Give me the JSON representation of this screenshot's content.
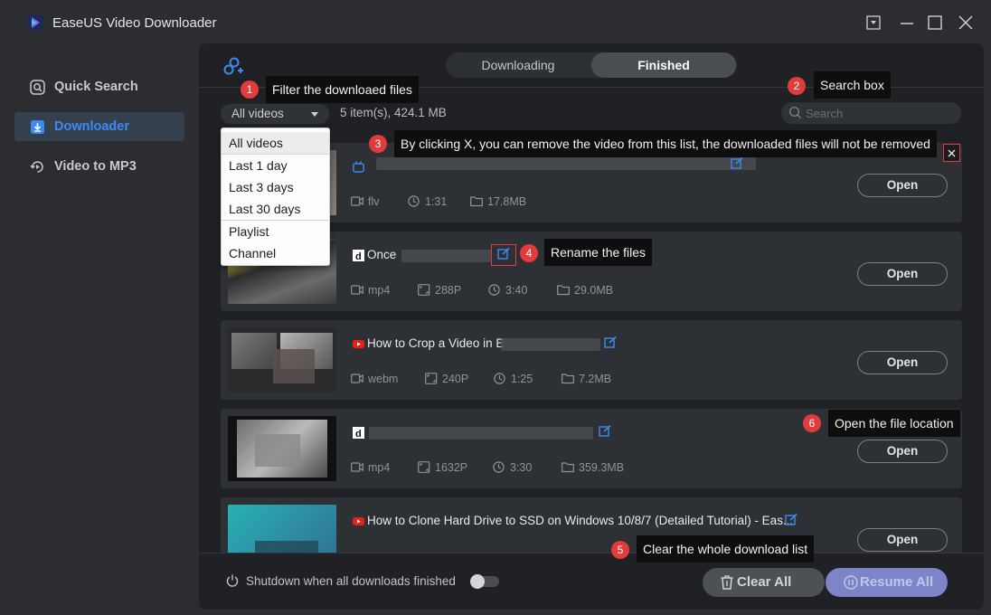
{
  "app": {
    "title": "EaseUS Video Downloader"
  },
  "sidebar": {
    "items": [
      {
        "label": "Quick Search",
        "icon": "search-icon",
        "active": false
      },
      {
        "label": "Downloader",
        "icon": "download-icon",
        "active": true
      },
      {
        "label": "Video to MP3",
        "icon": "convert-icon",
        "active": false
      }
    ]
  },
  "tabs": [
    {
      "label": "Downloading",
      "active": false
    },
    {
      "label": "Finished",
      "active": true
    }
  ],
  "filter": {
    "selected": "All videos",
    "count_text": "5 item(s), 424.1 MB",
    "options": [
      "All videos",
      "Last 1 day",
      "Last 3 days",
      "Last 30 days",
      "Playlist",
      "Channel"
    ]
  },
  "search": {
    "placeholder": "Search"
  },
  "videos": [
    {
      "title": "",
      "source": "bilibili-icon",
      "meta": [
        "flv",
        "1:31",
        "17.8MB"
      ],
      "open": "Open"
    },
    {
      "title": "Once",
      "source": "dailymotion-icon",
      "meta": [
        "mp4",
        "288P",
        "3:40",
        "29.0MB"
      ],
      "open": "Open"
    },
    {
      "title": "How to Crop a Video in E",
      "source": "youtube-icon",
      "meta": [
        "webm",
        "240P",
        "1:25",
        "7.2MB"
      ],
      "open": "Open"
    },
    {
      "title": "",
      "source": "dailymotion-icon",
      "meta": [
        "mp4",
        "1632P",
        "3:30",
        "359.3MB"
      ],
      "open": "Open"
    },
    {
      "title": "How to Clone Hard Drive to SSD on Windows 10/8/7 (Detailed Tutorial) - Eas...",
      "source": "youtube-icon",
      "meta": [],
      "open": "Open"
    }
  ],
  "footer": {
    "shutdown_label": "Shutdown when all downloads finished",
    "clear_all": "Clear All",
    "resume_all": "Resume All"
  },
  "annotations": [
    {
      "num": "1",
      "text": "Filter the downloaed files"
    },
    {
      "num": "2",
      "text": "Search box"
    },
    {
      "num": "3",
      "text": "By clicking X, you can remove the video from this list, the downloaded files will not be removed"
    },
    {
      "num": "4",
      "text": "Rename the files"
    },
    {
      "num": "5",
      "text": "Clear the whole download list"
    },
    {
      "num": "6",
      "text": "Open the file location"
    }
  ],
  "colors": {
    "accent": "#3d8bf0",
    "badge": "#e23b3b",
    "resume": "#7e84c8",
    "background": "#2b2d30",
    "panel": "#1f2124",
    "row": "#2d3034"
  }
}
